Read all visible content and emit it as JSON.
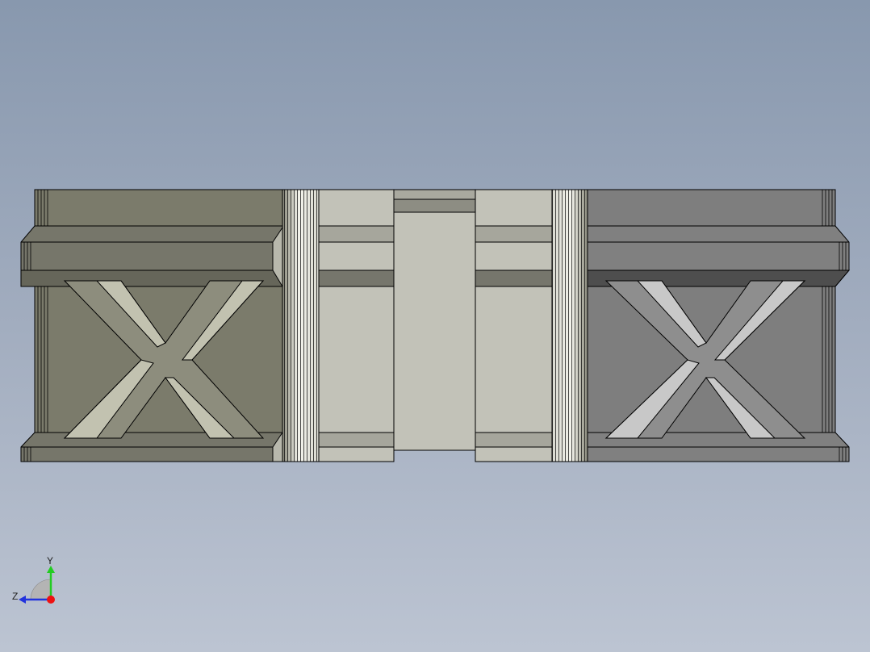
{
  "viewport": {
    "background_top": "#8898ae",
    "background_bottom": "#bcc4d2"
  },
  "model": {
    "left_block_color": "#7b7b6b",
    "right_block_color": "#7e7e7e",
    "center_face_color": "#c2c2b8",
    "edge_color": "#000000",
    "groove_marks": [
      "X",
      "X"
    ]
  },
  "triad": {
    "y_label": "Y",
    "z_label": "Z",
    "y_axis_color": "#22cc22",
    "z_axis_color": "#2233dd",
    "x_axis_color": "#ee1111"
  }
}
